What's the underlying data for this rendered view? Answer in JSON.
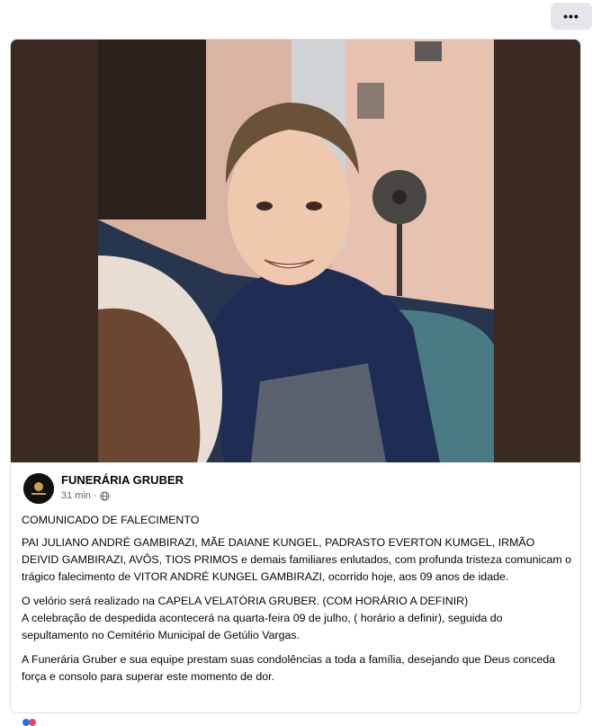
{
  "topbar": {
    "more_label": "•••"
  },
  "post": {
    "page_name": "FUNERÁRIA GRUBER",
    "time": "31 min",
    "separator": "·",
    "title": "COMUNICADO DE FALECIMENTO",
    "paragraph_1": "PAI JULIANO ANDRÉ GAMBIRAZI, MÃE DAIANE KUNGEL, PADRASTO EVERTON KUMGEL, IRMÃO DEIVID GAMBIRAZI, AVÔS, TIOS PRIMOS e demais familiares enlutados, com profunda tristeza comunicam o trágico falecimento de VITOR ANDRÉ KUNGEL GAMBIRAZI, ocorrido hoje, aos 09 anos de idade.",
    "paragraph_2_line_1": "O velório será realizado na CAPELA VELATÓRIA GRUBER.     (COM HORÁRIO A DEFINIR)",
    "paragraph_2_line_2": "A celebração de despedida acontecerá na quarta-feira 09 de julho, ( horário a definir), seguida do sepultamento no Cemitério Municipal de Getúlio Vargas.",
    "paragraph_3": "A Funerária Gruber e sua equipe prestam suas condolências a toda a família, desejando que Deus conceda força e consolo para superar este momento de dor."
  },
  "icons": {
    "more": "more-dots-icon",
    "privacy": "globe-icon",
    "avatar": "funeral-home-logo"
  },
  "colors": {
    "muted_text": "#65676b",
    "border": "#dadde1",
    "button_bg": "#e4e6eb"
  }
}
